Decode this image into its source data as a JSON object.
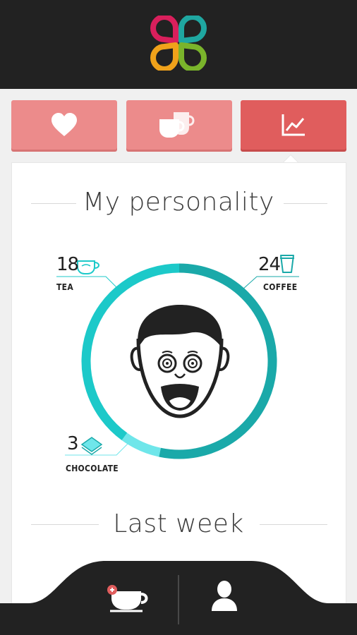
{
  "header": {
    "logo_icon": "clover-logo-icon"
  },
  "tabs": [
    {
      "icon": "heart-icon",
      "active": false
    },
    {
      "icon": "cups-icon",
      "active": false
    },
    {
      "icon": "chart-icon",
      "active": true
    }
  ],
  "personality": {
    "title": "My personality",
    "stats": [
      {
        "value": "18",
        "label": "TEA",
        "icon": "tea-cup-icon",
        "count": 18
      },
      {
        "value": "24",
        "label": "COFFEE",
        "icon": "coffee-cup-icon",
        "count": 24
      },
      {
        "value": "3",
        "label": "CHOCOLATE",
        "icon": "chocolate-icon",
        "count": 3
      }
    ],
    "avatar_icon": "surprised-face-icon"
  },
  "last_week": {
    "title": "Last week"
  },
  "footer": {
    "left_icon": "add-drink-cup-icon",
    "right_icon": "profile-icon"
  },
  "colors": {
    "header_bg": "#222222",
    "tab": "#ec8b8b",
    "tab_active": "#e05d5d",
    "ring_coffee": "#1aa9a9",
    "ring_tea": "#1cc9c9",
    "ring_chocolate": "#6fe6ea"
  }
}
